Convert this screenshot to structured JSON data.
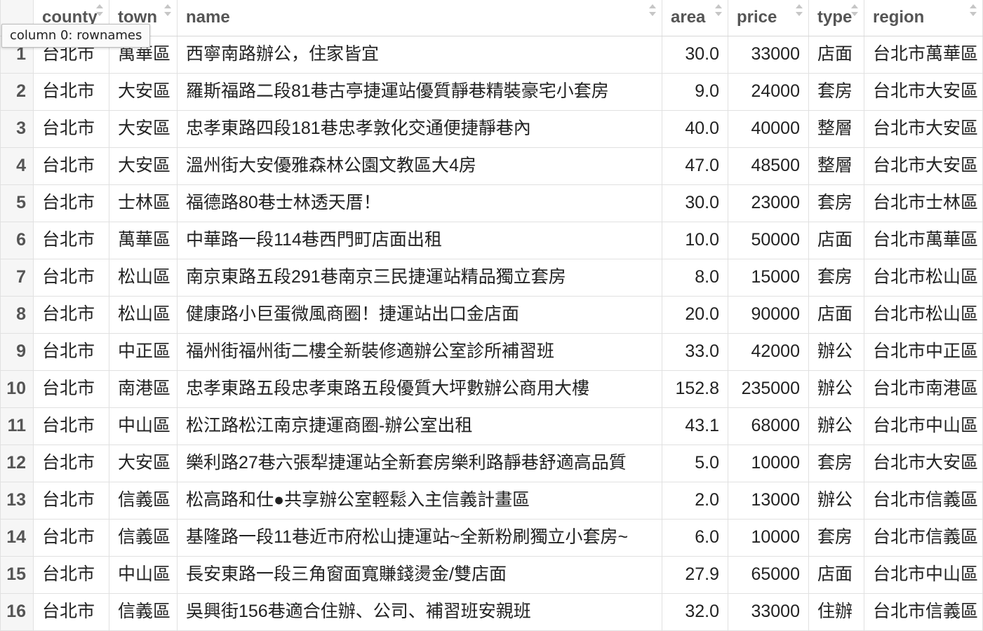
{
  "tooltip": {
    "text": "column 0: rownames"
  },
  "icons": {
    "sort": "sort-arrows-icon"
  },
  "columns": [
    "county",
    "town",
    "name",
    "area",
    "price",
    "type",
    "region"
  ],
  "rows": [
    [
      "1",
      "台北市",
      "萬華區",
      "西寧南路辦公，住家皆宜",
      "30.0",
      "33000",
      "店面",
      "台北市萬華區"
    ],
    [
      "2",
      "台北市",
      "大安區",
      "羅斯福路二段81巷古亭捷運站優質靜巷精裝豪宅小套房",
      "9.0",
      "24000",
      "套房",
      "台北市大安區"
    ],
    [
      "3",
      "台北市",
      "大安區",
      "忠孝東路四段181巷忠孝敦化交通便捷靜巷內",
      "40.0",
      "40000",
      "整層",
      "台北市大安區"
    ],
    [
      "4",
      "台北市",
      "大安區",
      "溫州街大安優雅森林公園文教區大4房",
      "47.0",
      "48500",
      "整層",
      "台北市大安區"
    ],
    [
      "5",
      "台北市",
      "士林區",
      "福德路80巷士林透天厝！",
      "30.0",
      "23000",
      "套房",
      "台北市士林區"
    ],
    [
      "6",
      "台北市",
      "萬華區",
      "中華路一段114巷西門町店面出租",
      "10.0",
      "50000",
      "店面",
      "台北市萬華區"
    ],
    [
      "7",
      "台北市",
      "松山區",
      "南京東路五段291巷南京三民捷運站精品獨立套房",
      "8.0",
      "15000",
      "套房",
      "台北市松山區"
    ],
    [
      "8",
      "台北市",
      "松山區",
      "健康路小巨蛋微風商圈！捷運站出口金店面",
      "20.0",
      "90000",
      "店面",
      "台北市松山區"
    ],
    [
      "9",
      "台北市",
      "中正區",
      "福州街福州街二樓全新裝修適辦公室診所補習班",
      "33.0",
      "42000",
      "辦公",
      "台北市中正區"
    ],
    [
      "10",
      "台北市",
      "南港區",
      "忠孝東路五段忠孝東路五段優質大坪數辦公商用大樓",
      "152.8",
      "235000",
      "辦公",
      "台北市南港區"
    ],
    [
      "11",
      "台北市",
      "中山區",
      "松江路松江南京捷運商圈-辦公室出租",
      "43.1",
      "68000",
      "辦公",
      "台北市中山區"
    ],
    [
      "12",
      "台北市",
      "大安區",
      "樂利路27巷六張犁捷運站全新套房樂利路靜巷舒適高品質",
      "5.0",
      "10000",
      "套房",
      "台北市大安區"
    ],
    [
      "13",
      "台北市",
      "信義區",
      "松高路和仕●共享辦公室輕鬆入主信義計畫區",
      "2.0",
      "13000",
      "辦公",
      "台北市信義區"
    ],
    [
      "14",
      "台北市",
      "信義區",
      "基隆路一段11巷近市府松山捷運站~全新粉刷獨立小套房~",
      "6.0",
      "10000",
      "套房",
      "台北市信義區"
    ],
    [
      "15",
      "台北市",
      "中山區",
      "長安東路一段三角窗面寬賺錢燙金/雙店面",
      "27.9",
      "65000",
      "店面",
      "台北市中山區"
    ],
    [
      "16",
      "台北市",
      "信義區",
      "吳興街156巷適合住辦、公司、補習班安親班",
      "32.0",
      "33000",
      "住辦",
      "台北市信義區"
    ]
  ]
}
